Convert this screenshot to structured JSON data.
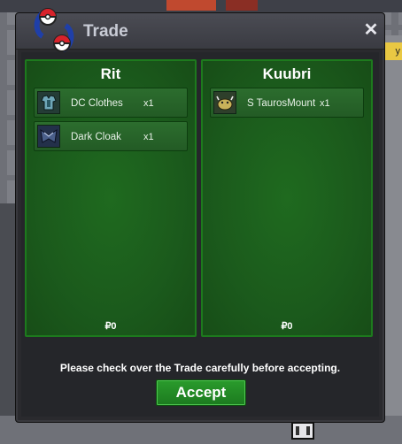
{
  "window": {
    "title": "Trade"
  },
  "side_tag": "y",
  "left_panel": {
    "player": "Rit",
    "items": [
      {
        "name": "DC Clothes",
        "qty": "x1",
        "icon": "clothes-icon"
      },
      {
        "name": "Dark Cloak",
        "qty": "x1",
        "icon": "cloak-icon"
      }
    ],
    "money": "₽0"
  },
  "right_panel": {
    "player": "Kuubri",
    "items": [
      {
        "name": "S Tauros\nMount",
        "name_line1": "S Tauros",
        "name_line2": "Mount",
        "qty": "x1",
        "icon": "tauros-mount-icon"
      }
    ],
    "money": "₽0"
  },
  "notice": "Please check over the Trade carefully before accepting.",
  "accept_label": "Accept",
  "colors": {
    "panel_green": "#1b5a1c",
    "accept_green": "#2a9b2c",
    "window_bg": "#2a2a2e"
  }
}
